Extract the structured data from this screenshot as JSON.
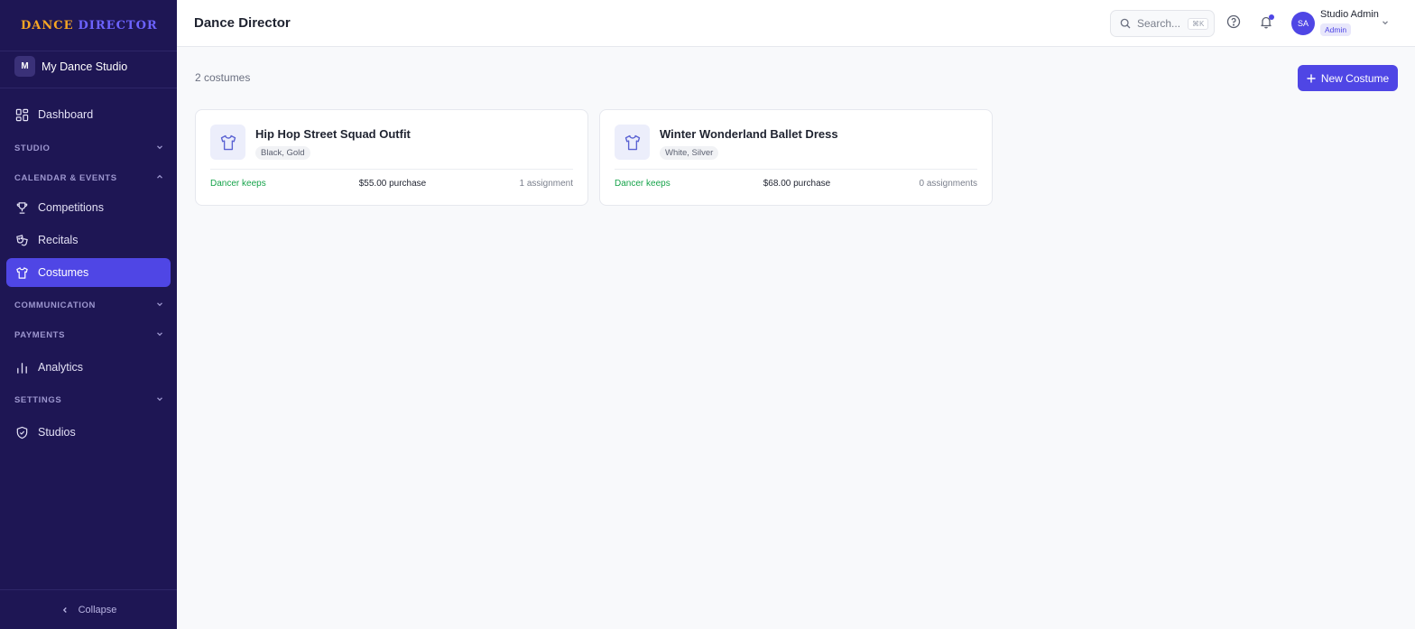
{
  "brand": {
    "part1": "DANCE",
    "part2": "DIRECTOR"
  },
  "studio": {
    "initial": "M",
    "name": "My Dance Studio"
  },
  "sidebar": {
    "dashboard": "Dashboard",
    "studio_section": "STUDIO",
    "calendar_section": "CALENDAR & EVENTS",
    "competitions": "Competitions",
    "recitals": "Recitals",
    "costumes": "Costumes",
    "communication_section": "COMMUNICATION",
    "payments_section": "PAYMENTS",
    "analytics": "Analytics",
    "settings_section": "SETTINGS",
    "studios": "Studios",
    "collapse": "Collapse",
    "active_item": "Costumes"
  },
  "header": {
    "title": "Dance Director",
    "search_placeholder": "Search...",
    "search_shortcut": "⌘K",
    "user_initials": "SA",
    "user_name": "Studio Admin",
    "user_role": "Admin"
  },
  "main": {
    "count_text": "2 costumes",
    "new_button": "New Costume",
    "costumes": [
      {
        "name": "Hip Hop Street Squad Outfit",
        "colors": "Black, Gold",
        "policy": "Dancer keeps",
        "price": "$55.00 purchase",
        "assignments": "1 assignment"
      },
      {
        "name": "Winter Wonderland Ballet Dress",
        "colors": "White, Silver",
        "policy": "Dancer keeps",
        "price": "$68.00 purchase",
        "assignments": "0 assignments"
      }
    ]
  },
  "colors": {
    "sidebar_bg": "#1e1654",
    "accent": "#4f46e5",
    "brand_orange": "#f5a524",
    "success_green": "#16a34a"
  }
}
